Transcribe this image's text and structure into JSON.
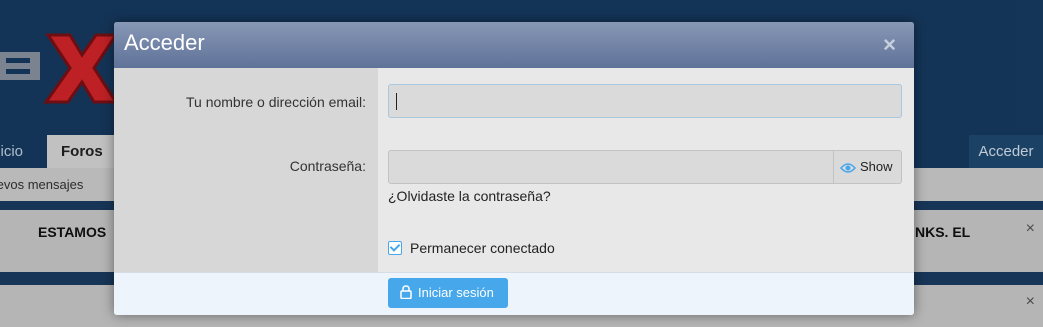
{
  "background": {
    "nav": {
      "inicio": "Inicio",
      "foros": "Foros",
      "acceder": "Acceder"
    },
    "subnav": {
      "new_messages": "Nuevos mensajes"
    },
    "notice": {
      "text_left": "ESTAMOS",
      "text_right": "NKS. EL",
      "close": "×"
    },
    "notice2": {
      "close": "×"
    }
  },
  "modal": {
    "title": "Acceder",
    "close": "×",
    "username": {
      "label": "Tu nombre o dirección email:",
      "value": ""
    },
    "password": {
      "label": "Contraseña:",
      "value": "",
      "show_label": "Show"
    },
    "forgot": "¿Olvidaste la contraseña?",
    "remember": {
      "label": "Permanecer conectado",
      "checked": true
    },
    "submit": "Iniciar sesión"
  },
  "colors": {
    "accent": "#47a7eb",
    "header_bg": "#173c63",
    "modal_head": "#6f7fa3"
  }
}
